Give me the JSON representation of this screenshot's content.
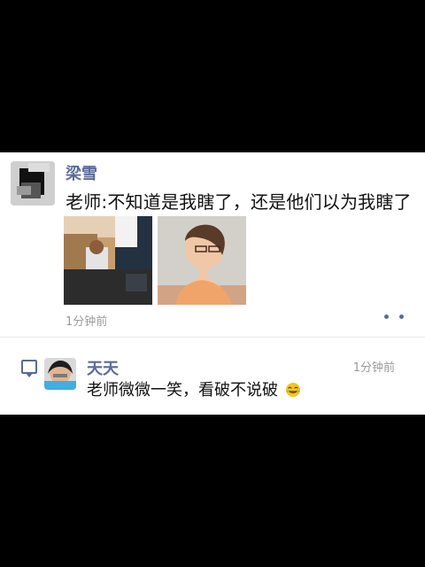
{
  "post": {
    "username": "梁雪",
    "text": "老师:不知道是我瞎了，还是他们以为我瞎了",
    "time": "1分钟前"
  },
  "comment": {
    "username": "天天",
    "text": "老师微微一笑，看破不说破",
    "time": "1分钟前"
  },
  "icons": [
    "more-icon",
    "comment-icon",
    "laughing-emoji-icon"
  ],
  "colors": {
    "name": "#5a6a98",
    "text": "#111111",
    "time": "#9a9a9a",
    "background": "#000000",
    "card": "#ffffff"
  }
}
